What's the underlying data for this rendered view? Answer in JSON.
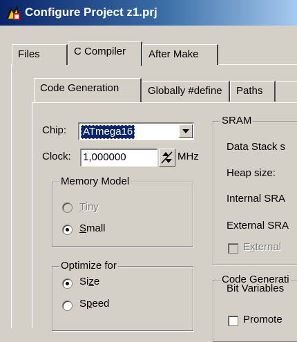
{
  "window": {
    "title": "Configure Project z1.prj"
  },
  "outer_tabs": [
    {
      "label": "Files"
    },
    {
      "label": "C Compiler"
    },
    {
      "label": "After Make"
    }
  ],
  "inner_tabs": [
    {
      "label": "Code Generation"
    },
    {
      "label": "Globally #define"
    },
    {
      "label": "Paths"
    }
  ],
  "chip": {
    "label": "Chip:",
    "value": "ATmega16"
  },
  "clock": {
    "label": "Clock:",
    "value": "1,000000",
    "unit": "MHz"
  },
  "memory_model": {
    "title": "Memory Model",
    "options": [
      {
        "pre": "",
        "acc": "T",
        "post": "iny",
        "selected": false,
        "disabled": true
      },
      {
        "pre": "",
        "acc": "S",
        "post": "mall",
        "selected": true,
        "disabled": false
      }
    ]
  },
  "optimize_for": {
    "title": "Optimize for",
    "options": [
      {
        "pre": "Si",
        "acc": "z",
        "post": "e",
        "selected": true
      },
      {
        "pre": "S",
        "acc": "p",
        "post": "eed",
        "selected": false
      }
    ]
  },
  "sram": {
    "title": "SRAM",
    "data_stack_label": "Data Stack s",
    "heap_size_label": "Heap size:",
    "internal_label": "Internal SRA",
    "external_label": "External SRA",
    "external_check": {
      "pre": "E",
      "acc": "x",
      "post": "ternal"
    }
  },
  "code_gen": {
    "title": "Code Generati",
    "bit_variables_label": "Bit Variables",
    "promote_label": "Promote"
  },
  "colors": {
    "title_bar_start": "#0a246a",
    "title_bar_end": "#a6caf0",
    "face": "#d4d0c8",
    "selection": "#0a246a"
  }
}
